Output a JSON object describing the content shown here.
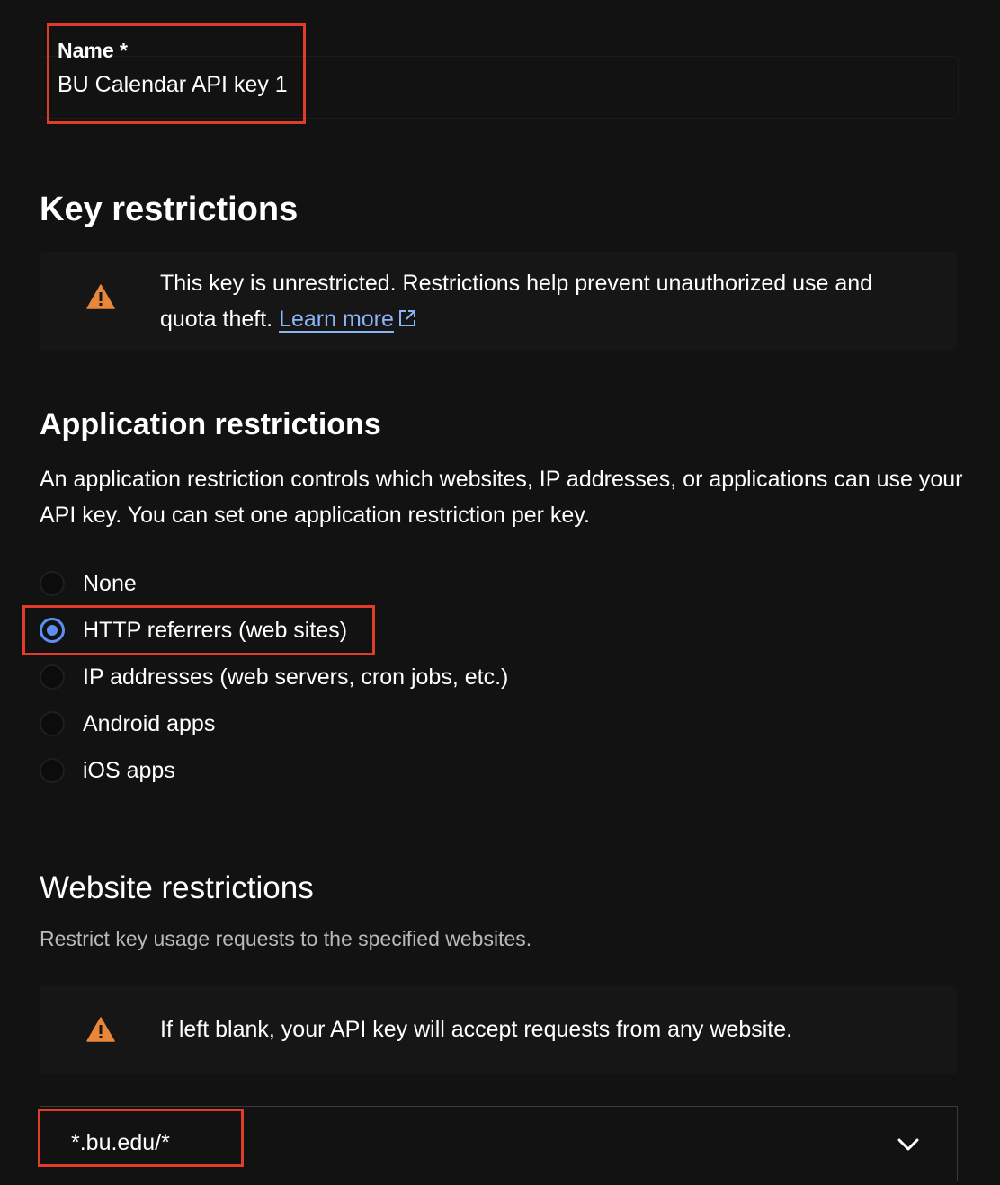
{
  "name_field": {
    "label": "Name *",
    "value": "BU Calendar API key 1"
  },
  "key_restrictions": {
    "heading": "Key restrictions",
    "warning_text": "This key is unrestricted. Restrictions help prevent unauthorized use and quota theft.",
    "learn_more": "Learn more"
  },
  "application_restrictions": {
    "heading": "Application restrictions",
    "description": "An application restriction controls which websites, IP addresses, or applications can use your API key. You can set one application restriction per key.",
    "options": [
      {
        "label": "None",
        "checked": false
      },
      {
        "label": "HTTP referrers (web sites)",
        "checked": true
      },
      {
        "label": "IP addresses (web servers, cron jobs, etc.)",
        "checked": false
      },
      {
        "label": "Android apps",
        "checked": false
      },
      {
        "label": "iOS apps",
        "checked": false
      }
    ]
  },
  "website_restrictions": {
    "heading": "Website restrictions",
    "description": "Restrict key usage requests to the specified websites.",
    "warning_text": "If left blank, your API key will accept requests from any website.",
    "items": [
      {
        "value": "*.bu.edu/*"
      }
    ]
  },
  "icons": {
    "warning": "warning-icon",
    "external_link": "external-link-icon",
    "expand": "chevron-down-icon"
  },
  "colors": {
    "background": "#121212",
    "accent": "#5b8ff0",
    "link": "#8ab4f8",
    "warning": "#e8863a",
    "highlight": "#e03c2a"
  }
}
